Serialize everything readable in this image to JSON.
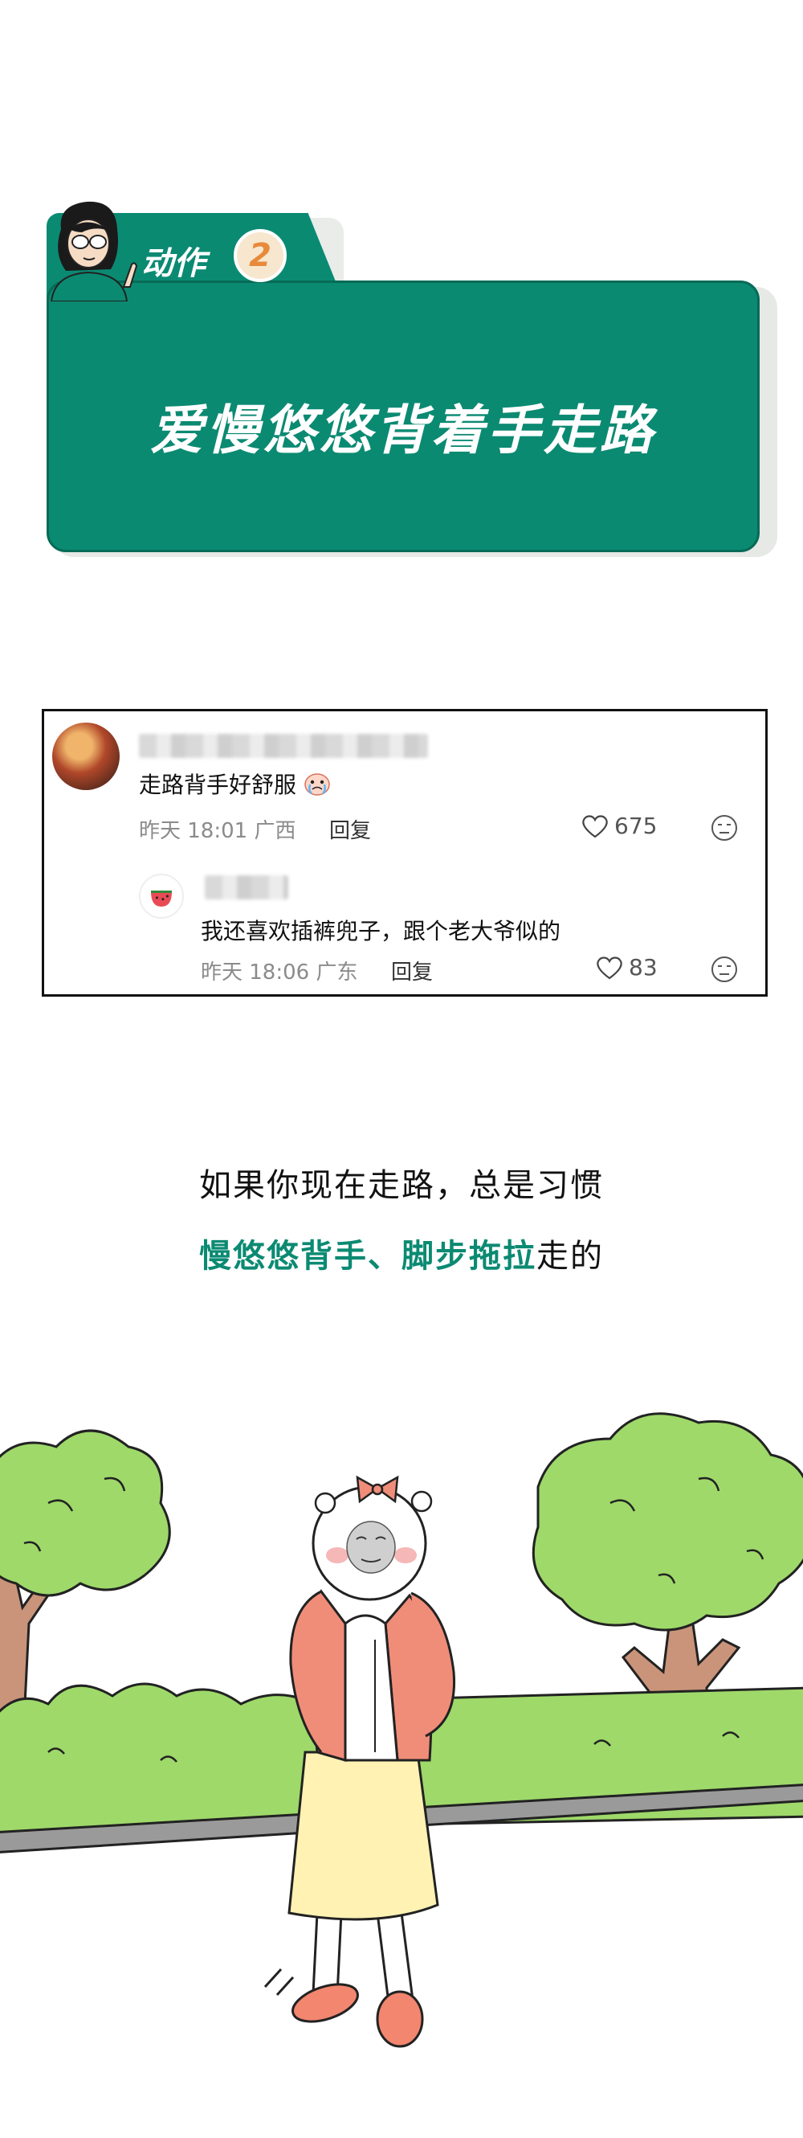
{
  "banner": {
    "action_label": "动作",
    "action_number": "2",
    "title": "爱慢悠悠背着手走路",
    "color": "#0b8a72"
  },
  "comment": {
    "text": "走路背手好舒服",
    "emoji": "crying-emoji",
    "meta": "昨天 18:01 广西",
    "reply_label": "回复",
    "likes": "675",
    "reply": {
      "text": "我还喜欢插裤兜子，跟个老大爷似的",
      "meta": "昨天 18:06 广东",
      "reply_label": "回复",
      "likes": "83"
    }
  },
  "paragraph": {
    "line1": "如果你现在走路，总是习惯",
    "line2_highlight": "慢悠悠背手、脚步拖拉",
    "line2_rest": "走的",
    "highlight_color": "#0b8a72"
  }
}
